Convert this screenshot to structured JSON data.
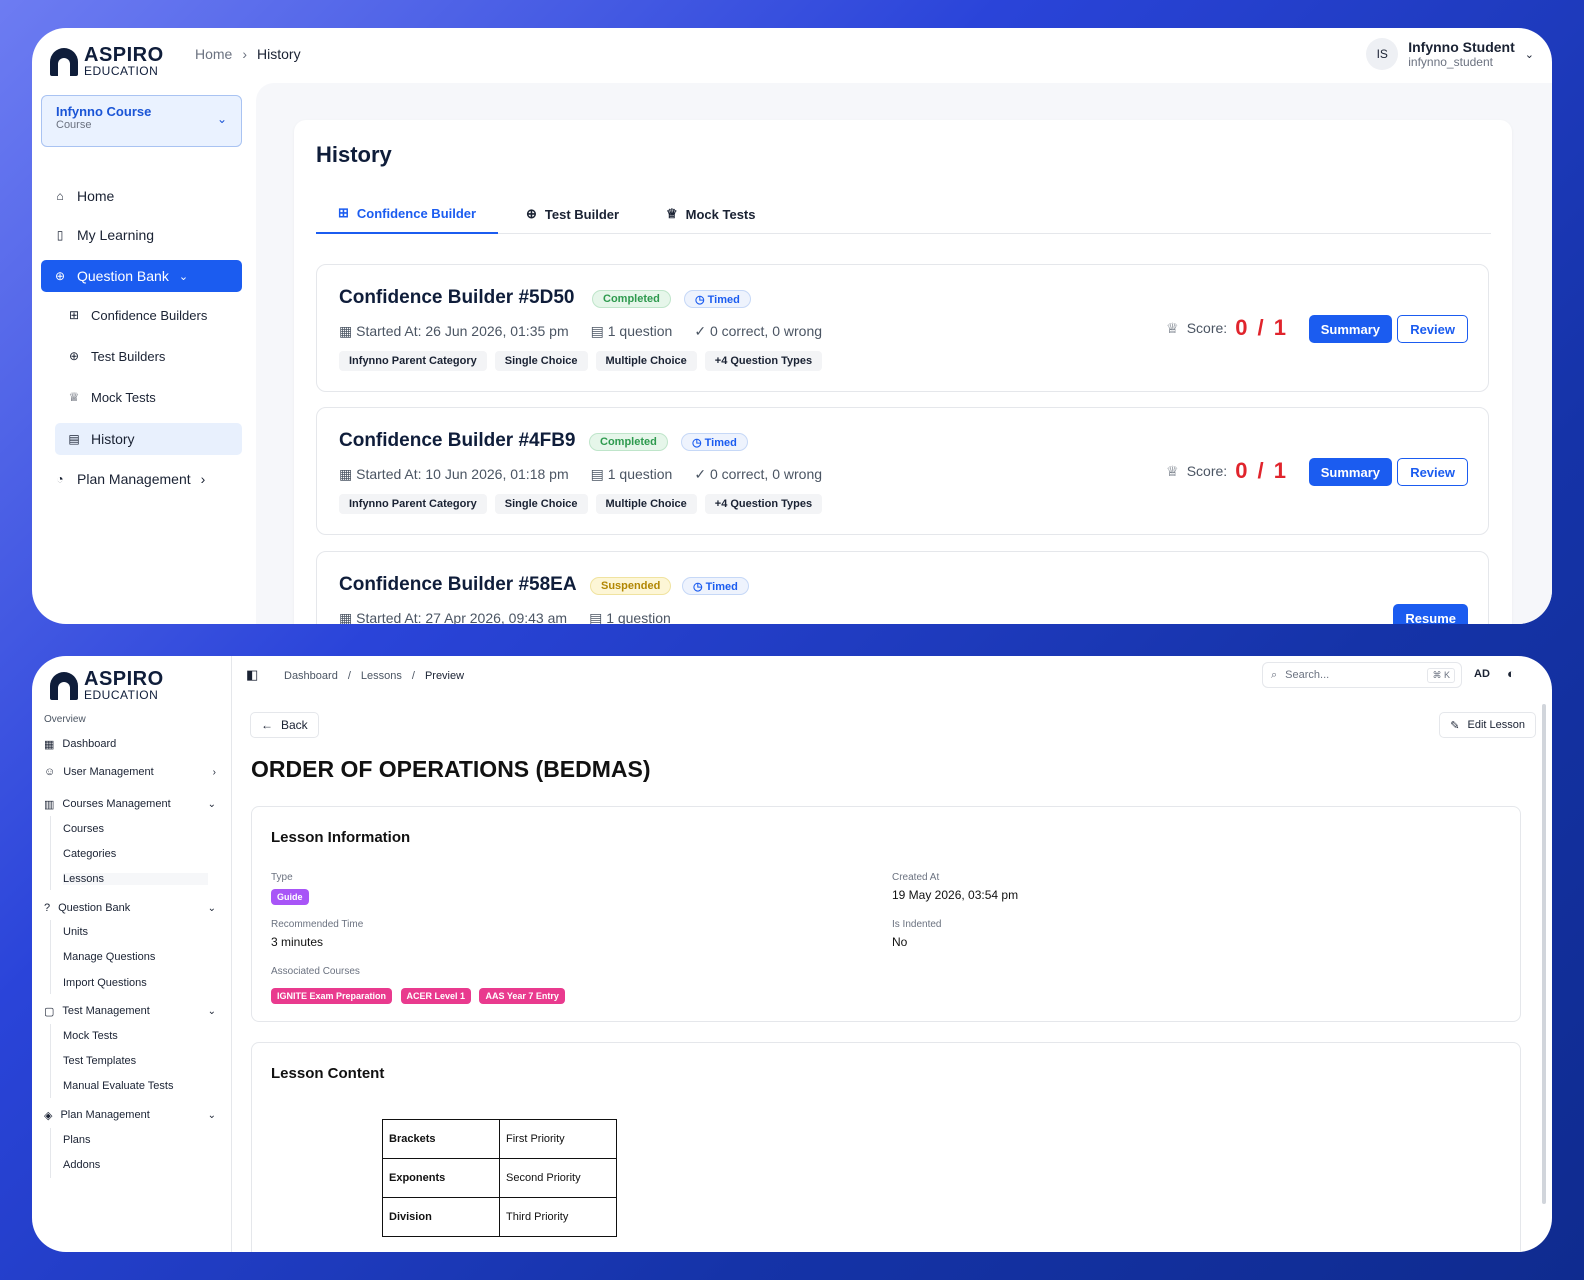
{
  "p1": {
    "brand": {
      "name": "ASPIRO",
      "sub": "EDUCATION"
    },
    "breadcrumb": [
      "Home",
      "History"
    ],
    "user": {
      "initials": "IS",
      "name": "Infynno Student",
      "handle": "infynno_student"
    },
    "course": {
      "name": "Infynno Course",
      "type": "Course"
    },
    "nav": [
      "Home",
      "My Learning",
      "Question Bank",
      "Confidence Builders",
      "Test Builders",
      "Mock Tests",
      "History",
      "Plan Management"
    ],
    "title": "History",
    "tabs": [
      "Confidence Builder",
      "Test Builder",
      "Mock Tests"
    ],
    "score_label": "Score:",
    "summary": "Summary",
    "review": "Review",
    "resume": "Resume",
    "cards": [
      {
        "name": "Confidence Builder #5D50",
        "status": "Completed",
        "timed": "Timed",
        "started": "Started At: 26 Jun 2026, 01:35 pm",
        "questions": "1 question",
        "result": "0 correct, 0 wrong",
        "score": "0 / 1",
        "chips": [
          "Infynno Parent Category",
          "Single Choice",
          "Multiple Choice",
          "+4 Question Types"
        ]
      },
      {
        "name": "Confidence Builder #4FB9",
        "status": "Completed",
        "timed": "Timed",
        "started": "Started At: 10 Jun 2026, 01:18 pm",
        "questions": "1 question",
        "result": "0 correct, 0 wrong",
        "score": "0 / 1",
        "chips": [
          "Infynno Parent Category",
          "Single Choice",
          "Multiple Choice",
          "+4 Question Types"
        ]
      },
      {
        "name": "Confidence Builder #58EA",
        "status": "Suspended",
        "timed": "Timed",
        "started": "Started At: 27 Apr 2026, 09:43 am",
        "questions": "1 question"
      }
    ]
  },
  "p2": {
    "brand": {
      "name": "ASPIRO",
      "sub": "EDUCATION"
    },
    "overview": "Overview",
    "nav": {
      "dashboard": "Dashboard",
      "user_mgmt": "User Management",
      "courses_mgmt": "Courses Management",
      "courses": "Courses",
      "categories": "Categories",
      "lessons": "Lessons",
      "question_bank": "Question Bank",
      "units": "Units",
      "manage_q": "Manage Questions",
      "import_q": "Import Questions",
      "test_mgmt": "Test Management",
      "mock_tests": "Mock Tests",
      "test_templates": "Test Templates",
      "manual_eval": "Manual Evaluate Tests",
      "plan_mgmt": "Plan Management",
      "plans": "Plans",
      "addons": "Addons"
    },
    "breadcrumb": [
      "Dashboard",
      "Lessons",
      "Preview"
    ],
    "search": {
      "placeholder": "Search...",
      "kbd": "⌘ K"
    },
    "user_initials": "AD",
    "back": "Back",
    "edit": "Edit Lesson",
    "title": "ORDER OF OPERATIONS (BEDMAS)",
    "info": {
      "heading": "Lesson Information",
      "type_label": "Type",
      "type": "Guide",
      "rec_label": "Recommended Time",
      "rec": "3 minutes",
      "assoc_label": "Associated Courses",
      "courses": [
        "IGNITE Exam Preparation",
        "ACER Level 1",
        "AAS Year 7 Entry"
      ],
      "created_label": "Created At",
      "created": "19 May 2026, 03:54 pm",
      "indented_label": "Is Indented",
      "indented": "No"
    },
    "content": {
      "heading": "Lesson Content",
      "rows": [
        [
          "Brackets",
          "First Priority"
        ],
        [
          "Exponents",
          "Second Priority"
        ],
        [
          "Division",
          "Third Priority"
        ]
      ]
    },
    "colors": {
      "guide": "#a855f7",
      "course_tag": "#e93a8e",
      "accent": "#1b5cf0"
    }
  }
}
